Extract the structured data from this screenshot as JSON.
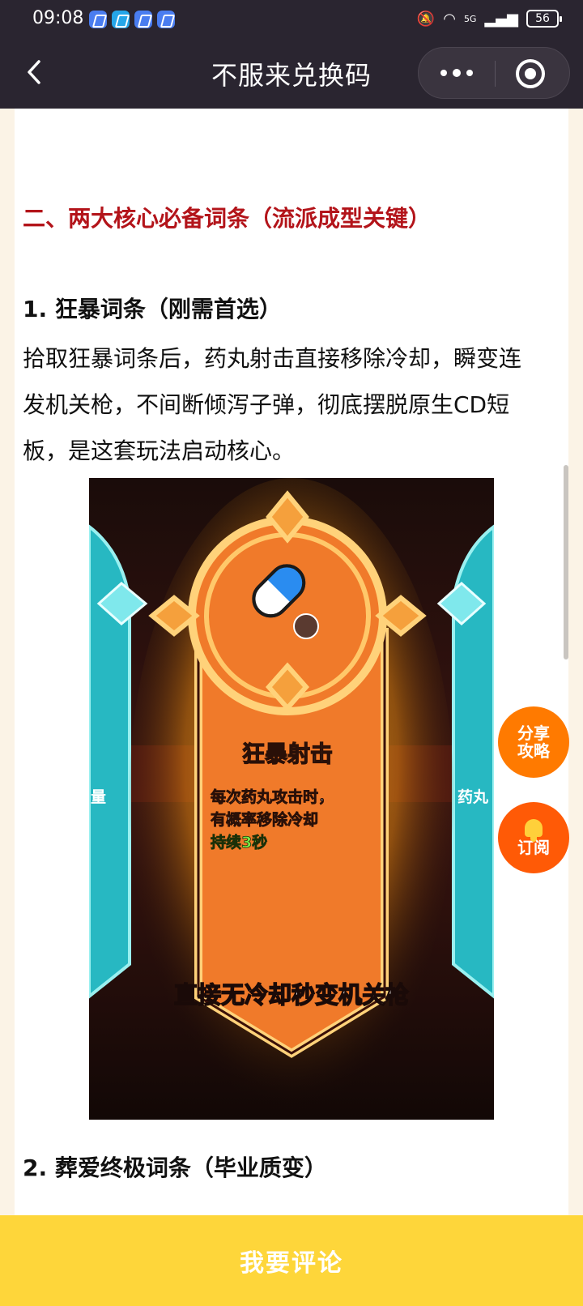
{
  "status_bar": {
    "time": "09:08",
    "network": "5G",
    "battery": "56"
  },
  "title_bar": {
    "title": "不服来兑换码",
    "icons": [
      "back-arrow-icon",
      "more-dots-icon",
      "close-target-icon"
    ]
  },
  "article": {
    "section_heading": "二、两大核心必备词条（流派成型关键）",
    "item1_heading": "1. 狂暴词条（刚需首选）",
    "item1_text": "拾取狂暴词条后，药丸射击直接移除冷却，瞬变连发机关枪，不间断倾泻子弹，彻底摆脱原生CD短板，是这套玩法启动核心。",
    "item2_heading": "2. 葬爱终极词条（毕业质变）",
    "image": {
      "card_title": "狂暴射击",
      "card_desc_line1": "每次药丸攻击时，",
      "card_desc_line2": "有概率移除冷却",
      "card_duration": "持续3秒",
      "caption": "直接无冷却秒变机关枪",
      "left_card_fragment": "量",
      "right_card_fragment": "药丸"
    }
  },
  "float_buttons": {
    "share_line1": "分享",
    "share_line2": "攻略",
    "subscribe": "订阅"
  },
  "comment_bar": {
    "label": "我要评论"
  },
  "colors": {
    "title_bar_bg": "#2a2530",
    "heading_red": "#b3141a",
    "comment_bar_bg": "#fed63a",
    "float_orange": "#ff7a00"
  }
}
